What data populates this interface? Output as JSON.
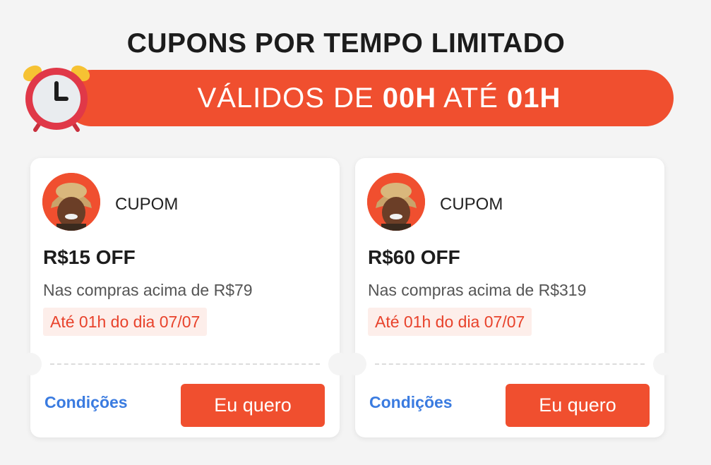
{
  "header": {
    "title": "CUPONS POR TEMPO LIMITADO",
    "banner": {
      "prefix": "VÁLIDOS DE ",
      "start": "00H",
      "middle": " ATÉ ",
      "end": "01H"
    },
    "icon": "alarm-clock-icon"
  },
  "colors": {
    "accent": "#f04f2f",
    "link": "#3a7be0",
    "expiry_bg": "#fdeeea",
    "expiry_text": "#e8422b"
  },
  "coupons": [
    {
      "label": "CUPOM",
      "amount": "R$15 OFF",
      "condition": "Nas compras acima de R$79",
      "expiry": "Até 01h do dia 07/07",
      "link": "Condições",
      "button": "Eu quero"
    },
    {
      "label": "CUPOM",
      "amount": "R$60 OFF",
      "condition": "Nas compras acima de R$319",
      "expiry": "Até 01h do dia 07/07",
      "link": "Condições",
      "button": "Eu quero"
    }
  ]
}
